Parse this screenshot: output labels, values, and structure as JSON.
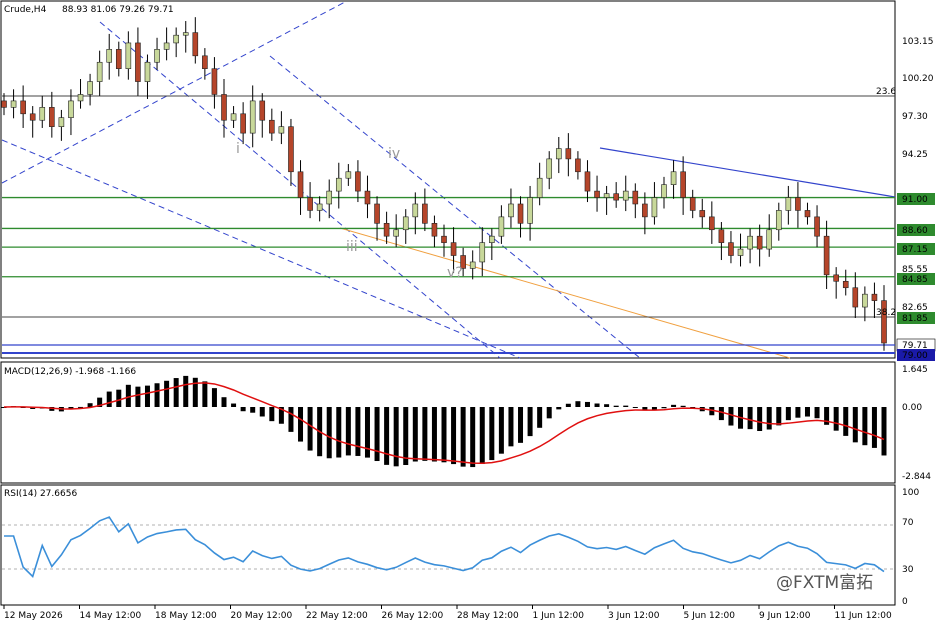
{
  "title_label": "Crude,H4",
  "ohlc_label": "88.93 81.06 79.26 79.71",
  "price_ticks": [
    "103.15",
    "100.20",
    "97.30",
    "94.25",
    "91.00",
    "88.60",
    "87.15",
    "85.55",
    "84.85",
    "82.65",
    "81.85",
    "79.71",
    "79.00"
  ],
  "fib_labels": [
    "23.6",
    "38.2"
  ],
  "wave_labels": [
    "i",
    "iii",
    "iv",
    "v?"
  ],
  "macd_label": "MACD(12,26,9) -1.968 -1.166",
  "macd_ticks": [
    "1.645",
    "0.00",
    "-2.844"
  ],
  "rsi_label": "RSI(14) 27.6656",
  "rsi_ticks": [
    "100",
    "70",
    "30",
    "0"
  ],
  "x_ticks": [
    "12 May 2026",
    "14 May 12:00",
    "18 May 12:00",
    "20 May 12:00",
    "22 May 12:00",
    "26 May 12:00",
    "28 May 12:00",
    "1 Jun 12:00",
    "3 Jun 12:00",
    "5 Jun 12:00",
    "9 Jun 12:00",
    "11 Jun 12:00"
  ],
  "watermark": "@FXTM富拓",
  "colors": {
    "bull": "#c8d89a",
    "bear": "#b5452a",
    "support": "#2e8b2e",
    "trend": "#3344cc",
    "macd_signal": "#e01010",
    "rsi": "#3b8fd9",
    "fib_fan": "#f0a040"
  },
  "chart_data": [
    {
      "type": "candlestick",
      "symbol": "Crude",
      "timeframe": "H4",
      "last_bar": {
        "open": 88.93,
        "high": 81.06,
        "low": 79.26,
        "close": 79.71
      },
      "y_axis_ticks": [
        103.15,
        100.2,
        97.3,
        94.25,
        91.0,
        88.6,
        87.15,
        85.55,
        84.85,
        82.65,
        81.85,
        79.71,
        79.0
      ],
      "horizontal_levels": [
        91.0,
        88.6,
        87.15,
        84.85,
        81.85,
        79.71,
        79.0
      ],
      "close_series_approx": [
        98.0,
        98.5,
        97.5,
        97.0,
        98.0,
        96.5,
        97.2,
        98.5,
        99.0,
        100.0,
        101.5,
        102.5,
        101.0,
        103.0,
        100.0,
        101.5,
        102.5,
        103.0,
        103.6,
        103.8,
        102.0,
        101.0,
        99.0,
        97.0,
        97.5,
        96.0,
        98.5,
        97.0,
        96.0,
        96.5,
        93.0,
        91.0,
        90.0,
        90.5,
        91.5,
        92.5,
        93.0,
        91.5,
        90.5,
        89.0,
        88.0,
        88.5,
        89.5,
        90.5,
        89.0,
        88.0,
        87.5,
        86.5,
        85.5,
        86.0,
        87.5,
        88.0,
        89.5,
        90.5,
        89.0,
        91.0,
        92.5,
        94.0,
        94.8,
        94.0,
        93.0,
        91.5,
        91.0,
        91.3,
        90.8,
        91.5,
        90.5,
        89.5,
        91.0,
        92.0,
        93.0,
        91.0,
        90.0,
        89.5,
        88.5,
        87.5,
        86.5,
        87.0,
        88.0,
        87.0,
        88.5,
        90.0,
        91.0,
        90.0,
        89.5,
        88.0,
        85.0,
        84.5,
        84.0,
        82.5,
        83.5,
        83.0,
        79.71
      ]
    },
    {
      "type": "bar",
      "name": "MACD(12,26,9)",
      "macd": -1.968,
      "signal": -1.166,
      "y_axis_ticks": [
        1.645,
        0.0,
        -2.844
      ]
    },
    {
      "type": "line",
      "name": "RSI(14)",
      "last": 27.6656,
      "ylim": [
        0,
        100
      ],
      "y_axis_ticks": [
        100,
        70,
        30,
        0
      ]
    }
  ]
}
